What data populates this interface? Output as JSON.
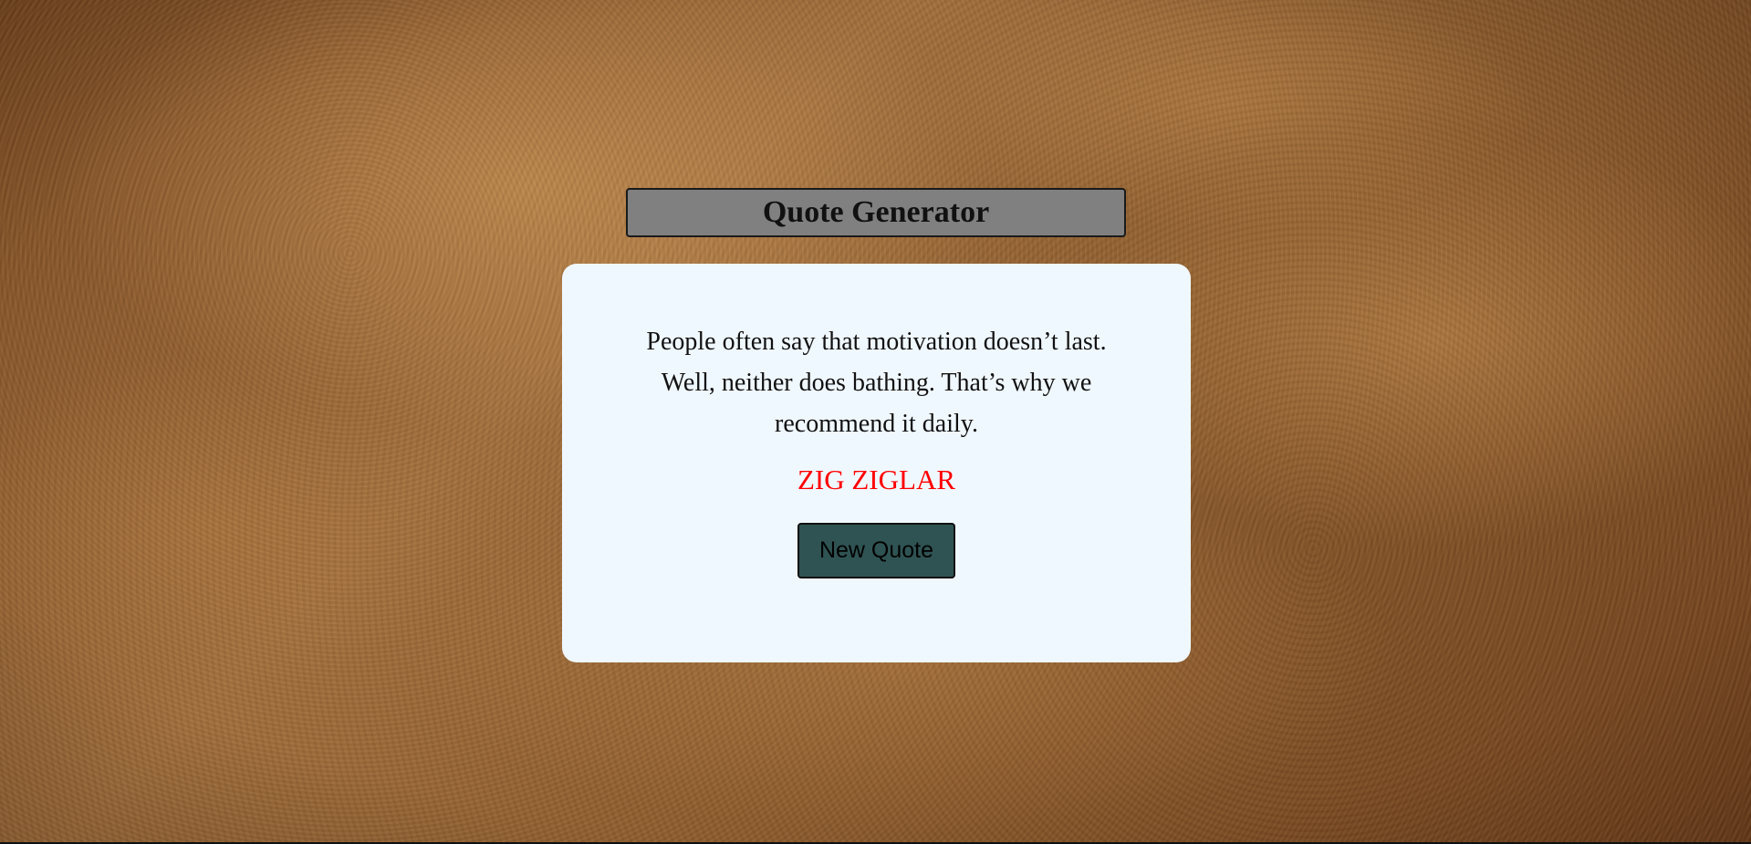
{
  "header": {
    "title": "Quote Generator"
  },
  "quote_card": {
    "text": "People often say that motivation doesn’t last. Well, neither does bathing. That’s why we recommend it daily.",
    "author": "ZIG ZIGLAR",
    "button_label": "New Quote"
  },
  "colors": {
    "title_box_bg": "#808080",
    "card_bg": "#f0f8ff",
    "author_text": "#ff0000",
    "button_bg": "#2f5353"
  }
}
